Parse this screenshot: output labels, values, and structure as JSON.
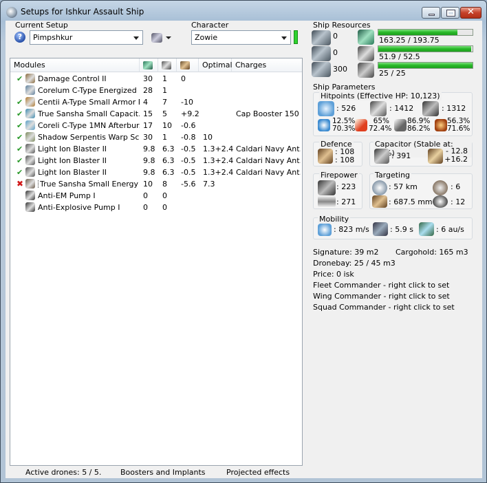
{
  "window": {
    "title": "Setups for Ishkur Assault Ship"
  },
  "setup": {
    "label": "Current Setup",
    "value": "Pimpshkur"
  },
  "character": {
    "label": "Character",
    "value": "Zowie"
  },
  "modules": {
    "headers": [
      "Modules",
      "",
      "",
      "",
      "Optimal",
      "Charges"
    ],
    "header_icons": [
      "cpu-icon",
      "powergrid-icon",
      "capacitor-icon"
    ],
    "rows": [
      {
        "status": "check",
        "icon": "armor-module-icon",
        "name": "Damage Control II",
        "cpu": "30",
        "pg": "1",
        "cap": "0",
        "optimal": "",
        "charges": "",
        "color": "#8a6a3c"
      },
      {
        "status": "",
        "icon": "energizer-icon",
        "name": "Corelum C-Type Energized ...",
        "cpu": "28",
        "pg": "1",
        "cap": "",
        "optimal": "",
        "charges": "",
        "color": "#5d7f9c"
      },
      {
        "status": "check",
        "icon": "armor-repairer-icon",
        "name": "Centii A-Type Small Armor R...",
        "cpu": "4",
        "pg": "7",
        "cap": "-10",
        "optimal": "",
        "charges": "",
        "color": "#b07a30"
      },
      {
        "status": "check",
        "icon": "cap-booster-icon",
        "name": "True Sansha Small Capacit...",
        "cpu": "15",
        "pg": "5",
        "cap": "+9.2",
        "optimal": "",
        "charges": "Cap Booster 150",
        "color": "#3a8ab0"
      },
      {
        "status": "check",
        "icon": "afterburner-icon",
        "name": "Coreli C-Type 1MN Afterbur...",
        "cpu": "17",
        "pg": "10",
        "cap": "-0.6",
        "optimal": "",
        "charges": "",
        "color": "#5aa0c8"
      },
      {
        "status": "check",
        "icon": "warp-scrambler-icon",
        "name": "Shadow Serpentis Warp Sc...",
        "cpu": "30",
        "pg": "1",
        "cap": "-0.8",
        "optimal": "10",
        "charges": "",
        "color": "#7c8a5c"
      },
      {
        "status": "check",
        "icon": "blaster-icon",
        "name": "Light Ion Blaster II",
        "cpu": "9.8",
        "pg": "6.3",
        "cap": "-0.5",
        "optimal": "1.3+2.4",
        "charges": "Caldari Navy Ant...",
        "color": "#555"
      },
      {
        "status": "check",
        "icon": "blaster-icon",
        "name": "Light Ion Blaster II",
        "cpu": "9.8",
        "pg": "6.3",
        "cap": "-0.5",
        "optimal": "1.3+2.4",
        "charges": "Caldari Navy Ant...",
        "color": "#555"
      },
      {
        "status": "check",
        "icon": "blaster-icon",
        "name": "Light Ion Blaster II",
        "cpu": "9.8",
        "pg": "6.3",
        "cap": "-0.5",
        "optimal": "1.3+2.4",
        "charges": "Caldari Navy Ant...",
        "color": "#555"
      },
      {
        "status": "cross",
        "icon": "energy-neutralizer-icon",
        "name": "True Sansha Small Energy ...",
        "cpu": "10",
        "pg": "8",
        "cap": "-5.6",
        "optimal": "7.3",
        "charges": "",
        "color": "#6a5a4a"
      },
      {
        "status": "",
        "icon": "rig-icon",
        "name": "Anti-EM Pump I",
        "cpu": "0",
        "pg": "0",
        "cap": "",
        "optimal": "",
        "charges": "",
        "color": "#333"
      },
      {
        "status": "",
        "icon": "rig-icon",
        "name": "Anti-Explosive Pump I",
        "cpu": "0",
        "pg": "0",
        "cap": "",
        "optimal": "",
        "charges": "",
        "color": "#333"
      }
    ]
  },
  "status_bar": {
    "drones": "Active drones: 5 / 5.",
    "boosters": "Boosters and Implants",
    "projected": "Projected effects"
  },
  "resources": {
    "title": "Ship Resources",
    "slots": [
      "0",
      "0",
      "300"
    ],
    "cpu": {
      "text": "163.25 / 193.75",
      "fraction": 0.843
    },
    "powergrid": {
      "text": "51.9 / 52.5",
      "fraction": 0.989
    },
    "calibration": {
      "text": "25 / 25",
      "fraction": 1.0
    }
  },
  "params": {
    "title": "Ship Parameters",
    "hitpoints": {
      "title": "Hitpoints (Effective HP: 10,123)",
      "shield": ": 526",
      "armor": ": 1412",
      "structure": ": 1312",
      "resists": [
        {
          "top": "12.5%",
          "bottom": "70.3%"
        },
        {
          "top": "65%",
          "bottom": "72.4%"
        },
        {
          "top": "86.9%",
          "bottom": "86.2%"
        },
        {
          "top": "56.3%",
          "bottom": "71.6%"
        }
      ]
    },
    "defence": {
      "title": "Defence",
      "a": ": 108",
      "b": ": 108"
    },
    "capacitor": {
      "title": "Capacitor (Stable at: 73%)",
      "amount": ": 391",
      "top": "- 12.8",
      "bottom": "+16.2"
    },
    "firepower": {
      "title": "Firepower",
      "a": ": 223",
      "b": ": 271"
    },
    "targeting": {
      "title": "Targeting",
      "range": ": 57 km",
      "targets": ": 6",
      "scanres": ": 687.5 mm",
      "sensor": ": 12"
    },
    "mobility": {
      "title": "Mobility",
      "speed": ": 823 m/s",
      "align": ": 5.9 s",
      "warp": ": 6 au/s"
    }
  },
  "info": {
    "signature": "Signature: 39 m2",
    "cargo": "Cargohold: 165 m3",
    "dronebay": "Dronebay: 25 / 45 m3",
    "price": "Price: 0 isk",
    "fleet": "Fleet Commander - right click to set",
    "wing": "Wing Commander - right click to set",
    "squad": "Squad Commander - right click to set"
  }
}
